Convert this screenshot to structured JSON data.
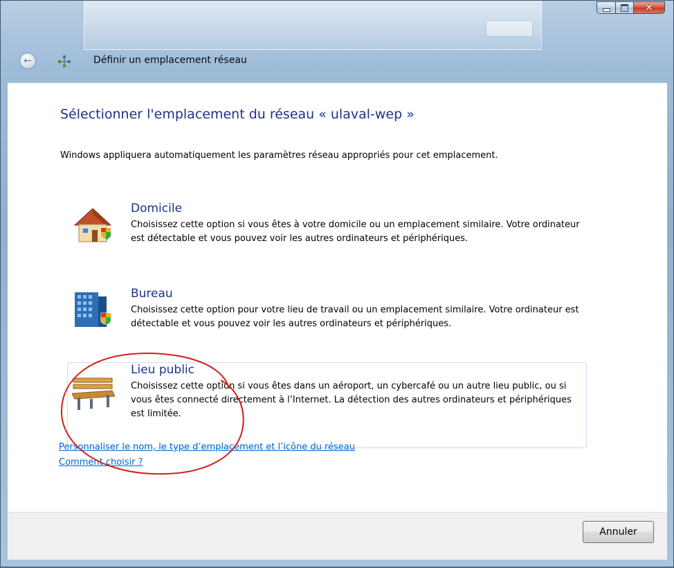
{
  "window": {
    "title": "Définir un emplacement réseau"
  },
  "content": {
    "heading": "Sélectionner l'emplacement du réseau « ulaval-wep »",
    "description": "Windows appliquera automatiquement les paramètres réseau appropriés pour cet emplacement.",
    "options": [
      {
        "title": "Domicile",
        "text": "Choisissez cette option si vous êtes à votre domicile ou un emplacement similaire. Votre ordinateur est détectable et vous pouvez voir les autres ordinateurs et périphériques.",
        "icon": "home-icon"
      },
      {
        "title": "Bureau",
        "text": "Choisissez cette option pour votre lieu de travail ou un emplacement similaire. Votre ordinateur est détectable et vous pouvez voir les autres ordinateurs et périphériques.",
        "icon": "office-building-icon"
      },
      {
        "title": "Lieu public",
        "text": "Choisissez cette option si vous êtes dans un aéroport, un cybercafé ou un autre lieu public, ou si vous êtes connecté directement à l’Internet. La détection des autres ordinateurs et périphériques est limitée.",
        "icon": "park-bench-icon"
      }
    ],
    "links": {
      "customize": "Personnaliser le nom, le type d’emplacement et l’icône du réseau",
      "how_to_choose": "Comment choisir ?"
    }
  },
  "footer": {
    "cancel_label": "Annuler"
  },
  "colors": {
    "heading": "#1e3287",
    "link": "#0066cc",
    "annotation_circle": "#d0201c"
  }
}
